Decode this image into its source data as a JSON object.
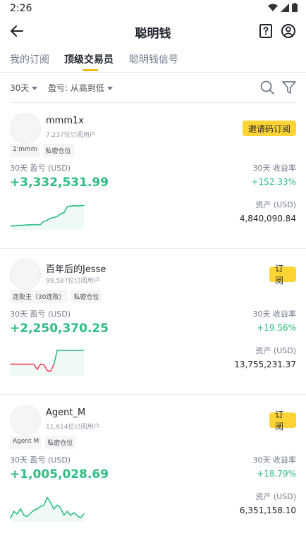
{
  "status_bar": {
    "time": "2:26"
  },
  "header": {
    "title": "聪明钱"
  },
  "tabs": [
    {
      "label": "我的订阅",
      "active": false
    },
    {
      "label": "顶级交易员",
      "active": true
    },
    {
      "label": "聪明钱信号",
      "active": false
    }
  ],
  "filters": {
    "period": "30天",
    "sort": "盈亏: 从高到低"
  },
  "colors": {
    "accent": "#fcd535",
    "positive": "#2ebd85",
    "negative": "#f6465d",
    "text": "#1e2329",
    "muted": "#707a8a"
  },
  "traders": [
    {
      "name": "mmm1x",
      "subscribers": "7,237位订阅用户",
      "button": "邀请码订阅",
      "tags": [
        "1'mmm",
        "私密仓位"
      ],
      "pnl_label": "30天 盈亏 (USD)",
      "pnl": "+3,332,531.99",
      "roi_label": "30天 收益率",
      "roi": "+152.33%",
      "assets_label": "资产 (USD)",
      "assets": "4,840,090.84",
      "spark": [
        0.1,
        0.1,
        0.12,
        0.12,
        0.13,
        0.14,
        0.14,
        0.15,
        0.14,
        0.16,
        0.28,
        0.32,
        0.4,
        0.43,
        0.47,
        0.58,
        0.62,
        0.86,
        0.88,
        0.9,
        0.88,
        0.9,
        0.9
      ],
      "spark_neg": []
    },
    {
      "name": "百年后的Jesse",
      "subscribers": "99,587位订阅用户",
      "button": "订阅",
      "tags": [
        "连败王（30连败）",
        "私密仓位"
      ],
      "pnl_label": "30天 盈亏 (USD)",
      "pnl": "+2,250,370.25",
      "roi_label": "30天 收益率",
      "roi": "+19.56%",
      "assets_label": "资产 (USD)",
      "assets": "13,755,231.37",
      "spark": [
        0.4,
        0.4,
        0.4,
        0.4,
        0.4,
        0.4,
        0.4,
        0.4,
        0.2,
        0.4,
        0.38,
        0.15,
        0.12,
        0.4,
        0.95,
        0.95,
        0.95,
        0.95,
        0.95,
        0.95,
        0.95,
        0.95,
        0.95
      ],
      "spark_neg": [
        0,
        1,
        2,
        3,
        4,
        5,
        6,
        7,
        8,
        9,
        10,
        11,
        12
      ]
    },
    {
      "name": "Agent_M",
      "subscribers": "11,614位订阅用户",
      "button": "订阅",
      "tags": [
        "Agent M",
        "私密仓位"
      ],
      "pnl_label": "30天 盈亏 (USD)",
      "pnl": "+1,005,028.69",
      "roi_label": "30天 收益率",
      "roi": "+18.79%",
      "assets_label": "资产 (USD)",
      "assets": "6,351,158.10",
      "spark": [
        0.1,
        0.35,
        0.25,
        0.45,
        0.2,
        0.15,
        0.28,
        0.4,
        0.45,
        0.55,
        0.6,
        0.9,
        0.7,
        0.45,
        0.6,
        0.5,
        0.2,
        0.35,
        0.2,
        0.3,
        0.18,
        0.1,
        0.25
      ],
      "spark_neg": []
    }
  ]
}
